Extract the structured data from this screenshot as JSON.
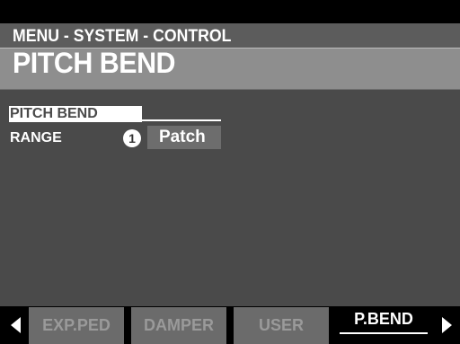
{
  "header": {
    "breadcrumb": "MENU - SYSTEM - CONTROL",
    "title": "PITCH BEND"
  },
  "params": {
    "section_label": "PITCH BEND",
    "range_label": "RANGE",
    "range_marker": "1",
    "range_value": "Patch"
  },
  "tabs": [
    {
      "label": "EXP.PED",
      "active": false
    },
    {
      "label": "DAMPER",
      "active": false
    },
    {
      "label": "USER",
      "active": false
    },
    {
      "label": "P.BEND",
      "active": true
    }
  ],
  "icons": {
    "prev": "left-arrow-icon",
    "next": "right-arrow-icon"
  },
  "colors": {
    "background": "#4a4a4a",
    "title_bar": "#8e8e8e",
    "tab_inactive": "#6b6b6b",
    "tab_active": "#000000"
  }
}
